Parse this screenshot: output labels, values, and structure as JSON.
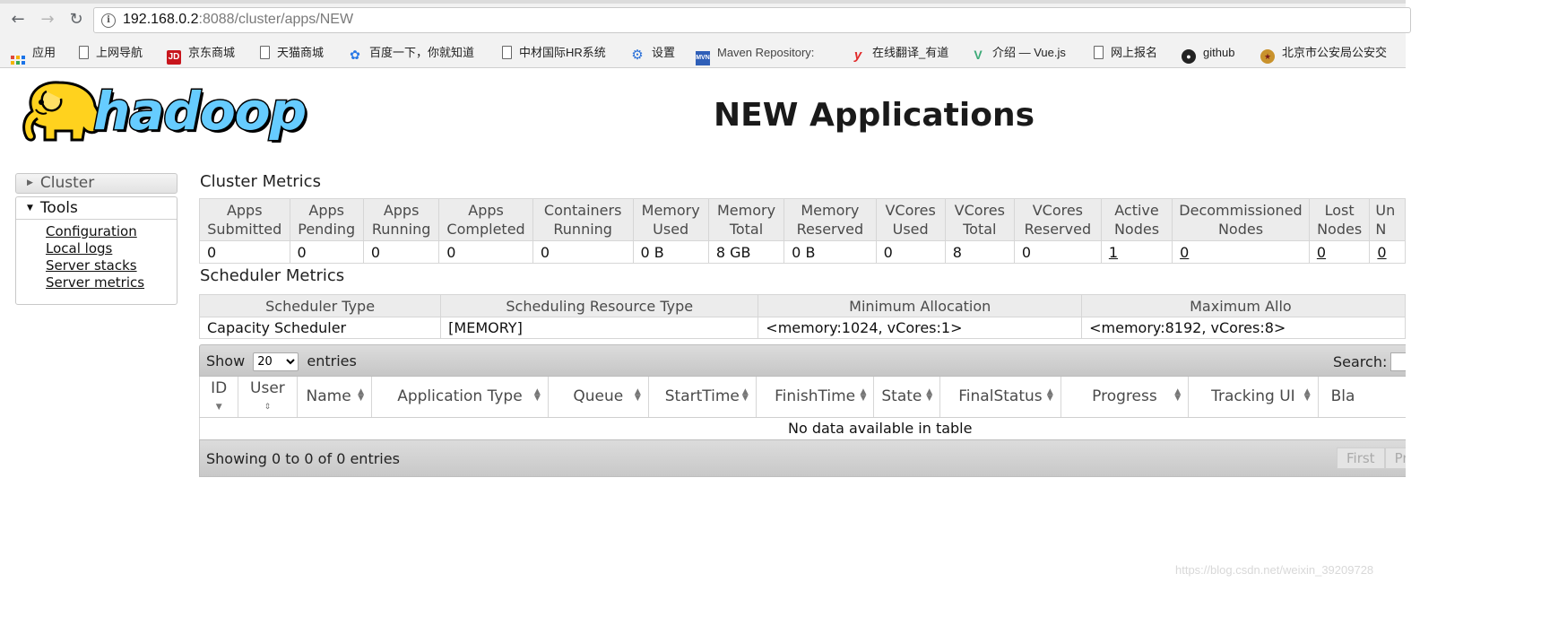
{
  "browser": {
    "url_host": "192.168.0.2",
    "url_rest": ":8088/cluster/apps/NEW",
    "bookmarks": [
      {
        "label": "应用",
        "icon": "apps-grid-icon"
      },
      {
        "label": "上网导航",
        "icon": "page-icon"
      },
      {
        "label": "京东商城",
        "icon": "jd-icon"
      },
      {
        "label": "天猫商城",
        "icon": "page-icon"
      },
      {
        "label": "百度一下，你就知道",
        "icon": "baidu-paw-icon"
      },
      {
        "label": "中材国际HR系统",
        "icon": "page-icon"
      },
      {
        "label": "设置",
        "icon": "gear-icon"
      },
      {
        "label": "Maven Repository:",
        "icon": "mvn-icon"
      },
      {
        "label": "在线翻译_有道",
        "icon": "youdao-icon"
      },
      {
        "label": "介绍 — Vue.js",
        "icon": "vue-icon"
      },
      {
        "label": "网上报名",
        "icon": "page-icon"
      },
      {
        "label": "github",
        "icon": "github-icon"
      },
      {
        "label": "北京市公安局公安交",
        "icon": "police-badge-icon"
      }
    ]
  },
  "logo": {
    "text": "hadoop"
  },
  "page": {
    "title": "NEW Applications"
  },
  "nav": {
    "cluster_label": "Cluster",
    "tools_label": "Tools",
    "tools_items": [
      "Configuration",
      "Local logs",
      "Server stacks",
      "Server metrics"
    ]
  },
  "cluster_metrics": {
    "title": "Cluster Metrics",
    "columns": [
      {
        "l1": "Apps",
        "l2": "Submitted",
        "value": "0",
        "link": false
      },
      {
        "l1": "Apps",
        "l2": "Pending",
        "value": "0",
        "link": false
      },
      {
        "l1": "Apps",
        "l2": "Running",
        "value": "0",
        "link": false
      },
      {
        "l1": "Apps",
        "l2": "Completed",
        "value": "0",
        "link": false
      },
      {
        "l1": "Containers",
        "l2": "Running",
        "value": "0",
        "link": false
      },
      {
        "l1": "Memory",
        "l2": "Used",
        "value": "0 B",
        "link": false
      },
      {
        "l1": "Memory",
        "l2": "Total",
        "value": "8 GB",
        "link": false
      },
      {
        "l1": "Memory",
        "l2": "Reserved",
        "value": "0 B",
        "link": false
      },
      {
        "l1": "VCores",
        "l2": "Used",
        "value": "0",
        "link": false
      },
      {
        "l1": "VCores",
        "l2": "Total",
        "value": "8",
        "link": false
      },
      {
        "l1": "VCores",
        "l2": "Reserved",
        "value": "0",
        "link": false
      },
      {
        "l1": "Active",
        "l2": "Nodes",
        "value": "1",
        "link": true
      },
      {
        "l1": "Decommissioned",
        "l2": "Nodes",
        "value": "0",
        "link": true
      },
      {
        "l1": "Lost",
        "l2": "Nodes",
        "value": "0",
        "link": true
      },
      {
        "l1": "Un",
        "l2": "N",
        "value": "0",
        "link": true
      }
    ]
  },
  "scheduler_metrics": {
    "title": "Scheduler Metrics",
    "headers": [
      "Scheduler Type",
      "Scheduling Resource Type",
      "Minimum Allocation",
      "Maximum Allo"
    ],
    "row": [
      "Capacity Scheduler",
      "[MEMORY]",
      "<memory:1024, vCores:1>",
      "<memory:8192, vCores:8>"
    ]
  },
  "apps": {
    "show_label": "Show",
    "entries_label": "entries",
    "page_size": "20",
    "search_label": "Search:",
    "columns": [
      "ID",
      "User",
      "Name",
      "Application Type",
      "Queue",
      "StartTime",
      "FinishTime",
      "State",
      "FinalStatus",
      "Progress",
      "Tracking UI",
      "Bla"
    ],
    "empty_message": "No data available in table",
    "footer_info": "Showing 0 to 0 of 0 entries",
    "pager": [
      "First",
      "Pre"
    ]
  },
  "watermark": "https://blog.csdn.net/weixin_39209728"
}
